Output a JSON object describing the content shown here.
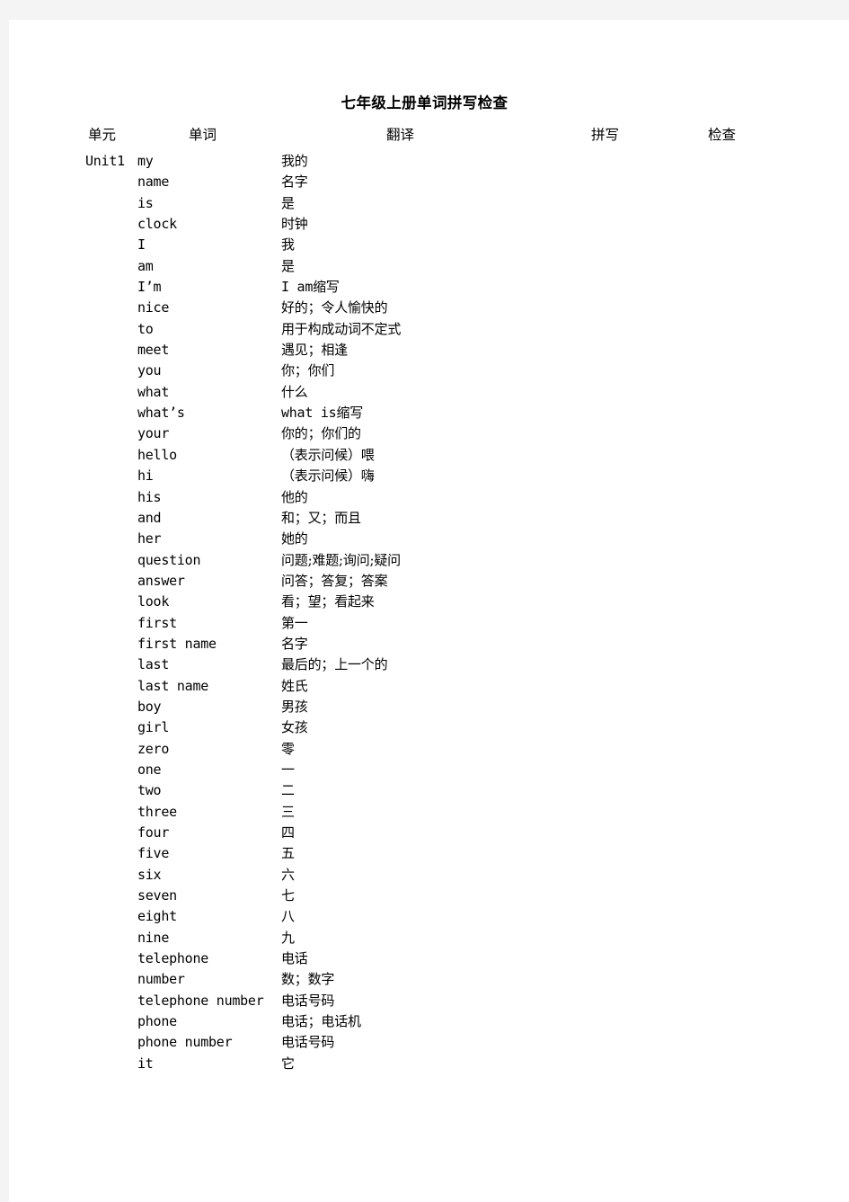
{
  "document": {
    "title": "七年级上册单词拼写检查"
  },
  "table": {
    "headers": {
      "unit": "单元",
      "word": "单词",
      "translation": "翻译",
      "spelling": "拼写",
      "check": "检查"
    },
    "rows": [
      {
        "unit": "Unit1",
        "word": "my",
        "translation": "我的",
        "spelling": "",
        "check": ""
      },
      {
        "unit": "",
        "word": "name",
        "translation": "名字",
        "spelling": "",
        "check": ""
      },
      {
        "unit": "",
        "word": "is",
        "translation": "是",
        "spelling": "",
        "check": ""
      },
      {
        "unit": "",
        "word": "clock",
        "translation": "时钟",
        "spelling": "",
        "check": ""
      },
      {
        "unit": "",
        "word": "I",
        "translation": "我",
        "spelling": "",
        "check": ""
      },
      {
        "unit": "",
        "word": "am",
        "translation": "是",
        "spelling": "",
        "check": ""
      },
      {
        "unit": "",
        "word": "I’m",
        "translation": "I am缩写",
        "spelling": "",
        "check": "",
        "mono_lead": true
      },
      {
        "unit": "",
        "word": "nice",
        "translation": "好的；令人愉快的",
        "spelling": "",
        "check": ""
      },
      {
        "unit": "",
        "word": "to",
        "translation": "用于构成动词不定式",
        "spelling": "",
        "check": ""
      },
      {
        "unit": "",
        "word": "meet",
        "translation": "遇见；相逢",
        "spelling": "",
        "check": ""
      },
      {
        "unit": "",
        "word": "you",
        "translation": "你；你们",
        "spelling": "",
        "check": ""
      },
      {
        "unit": "",
        "word": "what",
        "translation": "什么",
        "spelling": "",
        "check": ""
      },
      {
        "unit": "",
        "word": "what’s",
        "translation": "what is缩写",
        "spelling": "",
        "check": "",
        "mono_lead": true
      },
      {
        "unit": "",
        "word": "your",
        "translation": "你的；你们的",
        "spelling": "",
        "check": ""
      },
      {
        "unit": "",
        "word": "hello",
        "translation": "（表示问候）喂",
        "spelling": "",
        "check": ""
      },
      {
        "unit": "",
        "word": "hi",
        "translation": "（表示问候）嗨",
        "spelling": "",
        "check": ""
      },
      {
        "unit": "",
        "word": "his",
        "translation": "他的",
        "spelling": "",
        "check": ""
      },
      {
        "unit": "",
        "word": "and",
        "translation": "和；又；而且",
        "spelling": "",
        "check": ""
      },
      {
        "unit": "",
        "word": "her",
        "translation": "她的",
        "spelling": "",
        "check": ""
      },
      {
        "unit": "",
        "word": "question",
        "translation": "问题;难题;询问;疑问",
        "spelling": "",
        "check": ""
      },
      {
        "unit": "",
        "word": "answer",
        "translation": "问答；答复；答案",
        "spelling": "",
        "check": ""
      },
      {
        "unit": "",
        "word": "look",
        "translation": "看；望；看起来",
        "spelling": "",
        "check": ""
      },
      {
        "unit": "",
        "word": "first",
        "translation": "第一",
        "spelling": "",
        "check": ""
      },
      {
        "unit": "",
        "word": "first name",
        "translation": "名字",
        "spelling": "",
        "check": ""
      },
      {
        "unit": "",
        "word": "last",
        "translation": "最后的；上一个的",
        "spelling": "",
        "check": ""
      },
      {
        "unit": "",
        "word": "last name",
        "translation": "姓氏",
        "spelling": "",
        "check": ""
      },
      {
        "unit": "",
        "word": "boy",
        "translation": "男孩",
        "spelling": "",
        "check": ""
      },
      {
        "unit": "",
        "word": "girl",
        "translation": "女孩",
        "spelling": "",
        "check": ""
      },
      {
        "unit": "",
        "word": "zero",
        "translation": "零",
        "spelling": "",
        "check": ""
      },
      {
        "unit": "",
        "word": "one",
        "translation": "一",
        "spelling": "",
        "check": ""
      },
      {
        "unit": "",
        "word": "two",
        "translation": "二",
        "spelling": "",
        "check": ""
      },
      {
        "unit": "",
        "word": "three",
        "translation": "三",
        "spelling": "",
        "check": ""
      },
      {
        "unit": "",
        "word": "four",
        "translation": "四",
        "spelling": "",
        "check": ""
      },
      {
        "unit": "",
        "word": "five",
        "translation": "五",
        "spelling": "",
        "check": ""
      },
      {
        "unit": "",
        "word": "six",
        "translation": "六",
        "spelling": "",
        "check": ""
      },
      {
        "unit": "",
        "word": "seven",
        "translation": "七",
        "spelling": "",
        "check": ""
      },
      {
        "unit": "",
        "word": "eight",
        "translation": "八",
        "spelling": "",
        "check": ""
      },
      {
        "unit": "",
        "word": "nine",
        "translation": "九",
        "spelling": "",
        "check": ""
      },
      {
        "unit": "",
        "word": "telephone",
        "translation": "电话",
        "spelling": "",
        "check": ""
      },
      {
        "unit": "",
        "word": "number",
        "translation": "数；数字",
        "spelling": "",
        "check": ""
      },
      {
        "unit": "",
        "word": "telephone number",
        "translation": "电话号码",
        "spelling": "",
        "check": ""
      },
      {
        "unit": "",
        "word": "phone",
        "translation": "电话；电话机",
        "spelling": "",
        "check": ""
      },
      {
        "unit": "",
        "word": "phone number",
        "translation": "电话号码",
        "spelling": "",
        "check": ""
      },
      {
        "unit": "",
        "word": "it",
        "translation": "它",
        "spelling": "",
        "check": ""
      }
    ]
  }
}
